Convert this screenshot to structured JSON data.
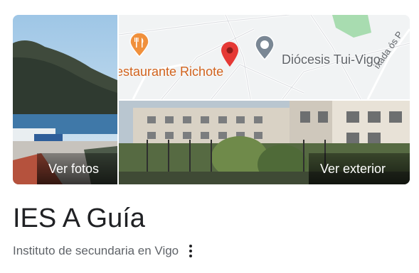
{
  "gallery": {
    "photos_label": "Ver fotos",
    "exterior_label": "Ver exterior"
  },
  "map": {
    "restaurant_label": "estaurante Richote",
    "diocese_label": "Diócesis Tui-Vigo",
    "street_label": "ixada ós P",
    "restaurant_icon": "fork-knife-icon",
    "place_pin_icon": "red-location-pin-icon",
    "diocese_icon": "gray-poi-circle-icon",
    "colors": {
      "restaurant_pin": "#f0903c",
      "restaurant_text": "#d0621d",
      "place_pin": "#e53935",
      "diocese_pin": "#7a8794",
      "park": "#a8dcb0"
    }
  },
  "place": {
    "name": "IES A Guía",
    "category": "Instituto de secundaria en Vigo",
    "more_icon": "more-vertical-icon"
  }
}
